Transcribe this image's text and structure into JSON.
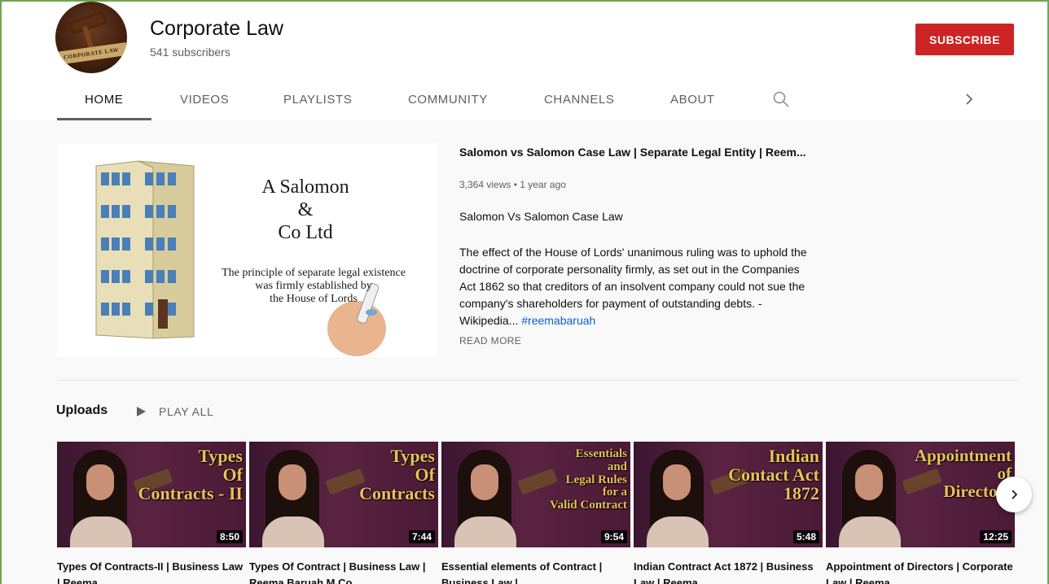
{
  "channel": {
    "name": "Corporate Law",
    "subscribers": "541 subscribers",
    "avatar_text": "CORPORATE LAW",
    "subscribe_label": "SUBSCRIBE"
  },
  "tabs": [
    {
      "label": "HOME",
      "active": true
    },
    {
      "label": "VIDEOS",
      "active": false
    },
    {
      "label": "PLAYLISTS",
      "active": false
    },
    {
      "label": "COMMUNITY",
      "active": false
    },
    {
      "label": "CHANNELS",
      "active": false
    },
    {
      "label": "ABOUT",
      "active": false
    }
  ],
  "icons": {
    "search": "search-icon",
    "tabs_next": "chevron-right-icon",
    "play_all": "play-icon",
    "carousel_next": "chevron-right-icon"
  },
  "featured": {
    "thumbnail": {
      "heading_line1": "A Salomon",
      "heading_line2": "&",
      "heading_line3": "Co Ltd",
      "caption_line1": "The principle of separate legal existence",
      "caption_line2": "was firmly established by",
      "caption_line3": "the House of Lords"
    },
    "title": "Salomon vs Salomon Case Law | Separate Legal Entity | Reem...",
    "meta": "3,364 views • 1 year ago",
    "subtitle": "Salomon Vs Salomon Case Law",
    "description": "The effect of the House of Lords' unanimous ruling was to uphold the doctrine of corporate personality firmly, as set out in the Companies Act 1862 so that creditors of an insolvent company could not sue the company's shareholders for payment of outstanding debts. -Wikipedia... ",
    "hashtag": "#reemabaruah",
    "read_more": "READ MORE"
  },
  "uploads": {
    "title": "Uploads",
    "play_all": "PLAY ALL",
    "videos": [
      {
        "thumb_text": "Types\nOf\nContracts - II",
        "duration": "8:50",
        "title": "Types Of Contracts-II | Business Law | Reema..."
      },
      {
        "thumb_text": "Types\nOf\nContracts",
        "duration": "7:44",
        "title": "Types Of Contract | Business Law | Reema Baruah M.Co..."
      },
      {
        "thumb_text": "Essentials\nand\nLegal Rules\nfor a\nValid Contract",
        "duration": "9:54",
        "title": "Essential elements of Contract | Business Law |..."
      },
      {
        "thumb_text": "Indian\nContact Act\n1872",
        "duration": "5:48",
        "title": "Indian Contract Act 1872 | Business Law | Reema..."
      },
      {
        "thumb_text": "Appointment\nof\nDirectors",
        "duration": "12:25",
        "title": "Appointment of Directors | Corporate Law | Reema..."
      }
    ]
  },
  "colors": {
    "subscribe": "#cc2424",
    "frame_border": "#6aa84f",
    "hashtag": "#065fd4",
    "thumb_text": "#e8c25a"
  }
}
